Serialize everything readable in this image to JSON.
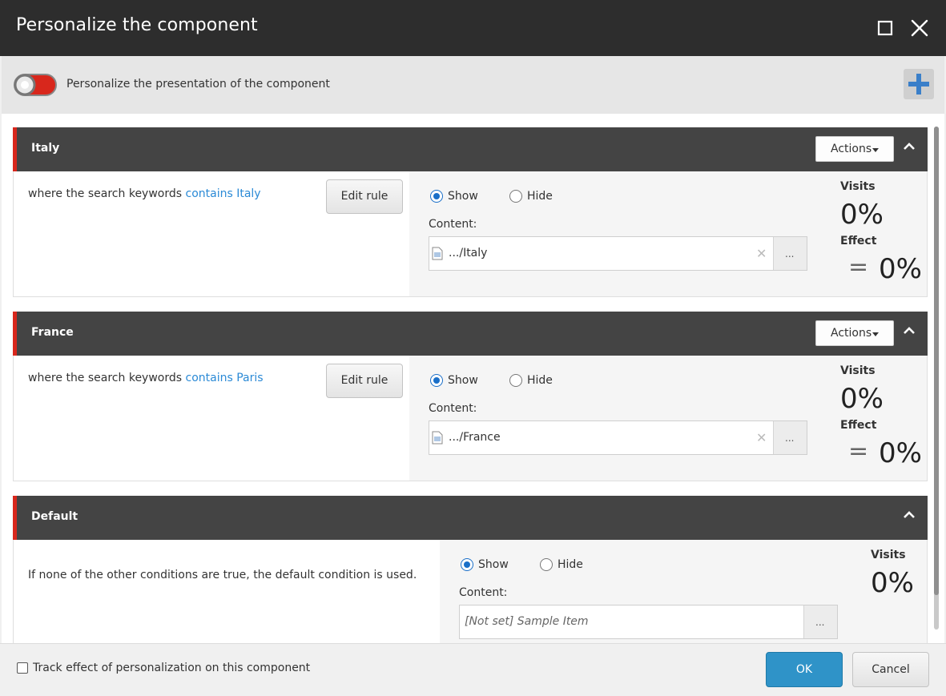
{
  "dialog": {
    "title": "Personalize the component",
    "maximize_icon": "maximize-icon",
    "close_icon": "close-icon"
  },
  "header": {
    "toggle_icon": "toggle-switch-icon",
    "label": "Personalize the presentation of the component",
    "add_icon": "plus-icon",
    "accent_color": "#d8271c",
    "add_color": "#3a7fc9"
  },
  "rules": [
    {
      "name": "Italy",
      "actions_label": "Actions",
      "condition_prefix": "where the search keywords",
      "condition_link": "contains Italy",
      "edit_label": "Edit rule",
      "show_label": "Show",
      "hide_label": "Hide",
      "selected": "Show",
      "content_label": "Content:",
      "content_value": ".../Italy",
      "browse_label": "...",
      "visits_label": "Visits",
      "visits_value": "0%",
      "effect_label": "Effect",
      "effect_symbol": "=",
      "effect_value": "0%"
    },
    {
      "name": "France",
      "actions_label": "Actions",
      "condition_prefix": "where the search keywords",
      "condition_link": "contains Paris",
      "edit_label": "Edit rule",
      "show_label": "Show",
      "hide_label": "Hide",
      "selected": "Show",
      "content_label": "Content:",
      "content_value": ".../France",
      "browse_label": "...",
      "visits_label": "Visits",
      "visits_value": "0%",
      "effect_label": "Effect",
      "effect_symbol": "=",
      "effect_value": "0%"
    }
  ],
  "default_rule": {
    "name": "Default",
    "description": "If none of the other conditions are true, the default condition is used.",
    "show_label": "Show",
    "hide_label": "Hide",
    "selected": "Show",
    "content_label": "Content:",
    "content_placeholder": "[Not set] Sample Item",
    "browse_label": "...",
    "visits_label": "Visits",
    "visits_value": "0%"
  },
  "footer": {
    "track_label": "Track effect of personalization on this component",
    "track_checked": false,
    "ok_label": "OK",
    "cancel_label": "Cancel",
    "ok_color": "#2f93c8"
  }
}
